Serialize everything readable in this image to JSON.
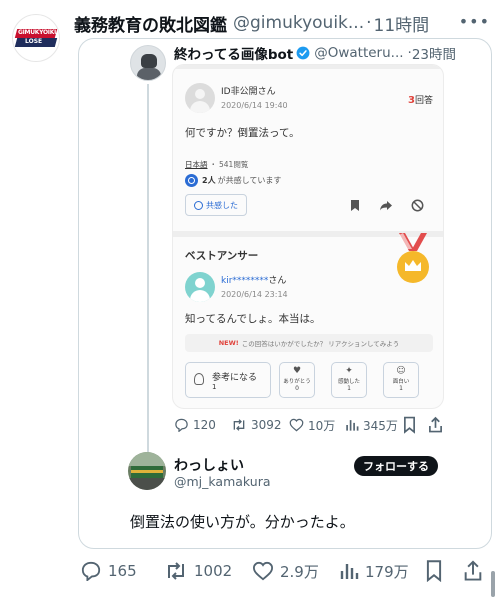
{
  "tweet": {
    "author_name": "義務教育の敗北図鑑",
    "author_handle": "@gimukyouik...",
    "separator": "·",
    "time": "11時間",
    "more_icon": "more-dots-icon",
    "avatar_logo_line1": "GIMUKYOIKU",
    "avatar_logo_line2": "LOSE",
    "stats": {
      "replies": "165",
      "retweets": "1002",
      "likes": "2.9万",
      "views": "179万"
    }
  },
  "quoted": {
    "author_name": "終わってる画像bot",
    "author_handle": "@Owatteru...",
    "separator": "·",
    "time": "23時間",
    "stats": {
      "replies": "120",
      "retweets": "3092",
      "likes": "10万",
      "views": "345万"
    }
  },
  "screenshot": {
    "question_user": "ID非公開",
    "question_user_suffix": "さん",
    "question_date": "2020/6/14 19:40",
    "answer_count": "3",
    "answer_count_suffix": "回答",
    "question_text": "何ですか？倒置法って。",
    "language": "日本語",
    "meta_sep": "・",
    "views": "541閲覧",
    "empathy_count": "2人",
    "empathy_text": "が共感しています",
    "empathy_button": "共感した",
    "best_answer_title": "ベストアンサー",
    "answer_user": "kir********",
    "answer_user_suffix": "さん",
    "answer_date": "2020/6/14 23:14",
    "answer_text": "知ってるんでしょ。本当は。",
    "reaction_new": "NEW!",
    "reaction_prompt": "この回答はいかがでしたか？ リアクションしてみよう",
    "reactions": [
      {
        "label": "参考になる",
        "count": "1"
      },
      {
        "label": "ありがとう",
        "count": "0"
      },
      {
        "label": "感動した",
        "count": "1"
      },
      {
        "label": "面白い",
        "count": "1"
      }
    ]
  },
  "reply": {
    "author_name": "わっしょい",
    "author_handle": "@mj_kamakura",
    "follow_label": "フォローする",
    "text": "倒置法の使い方が。分かったよ。"
  },
  "colors": {
    "text_primary": "#0f1419",
    "text_secondary": "#536471",
    "border": "#cfd9de",
    "verified": "#1d9bf0",
    "accent_red": "#e0433c",
    "accent_blue": "#2b6cd4"
  }
}
